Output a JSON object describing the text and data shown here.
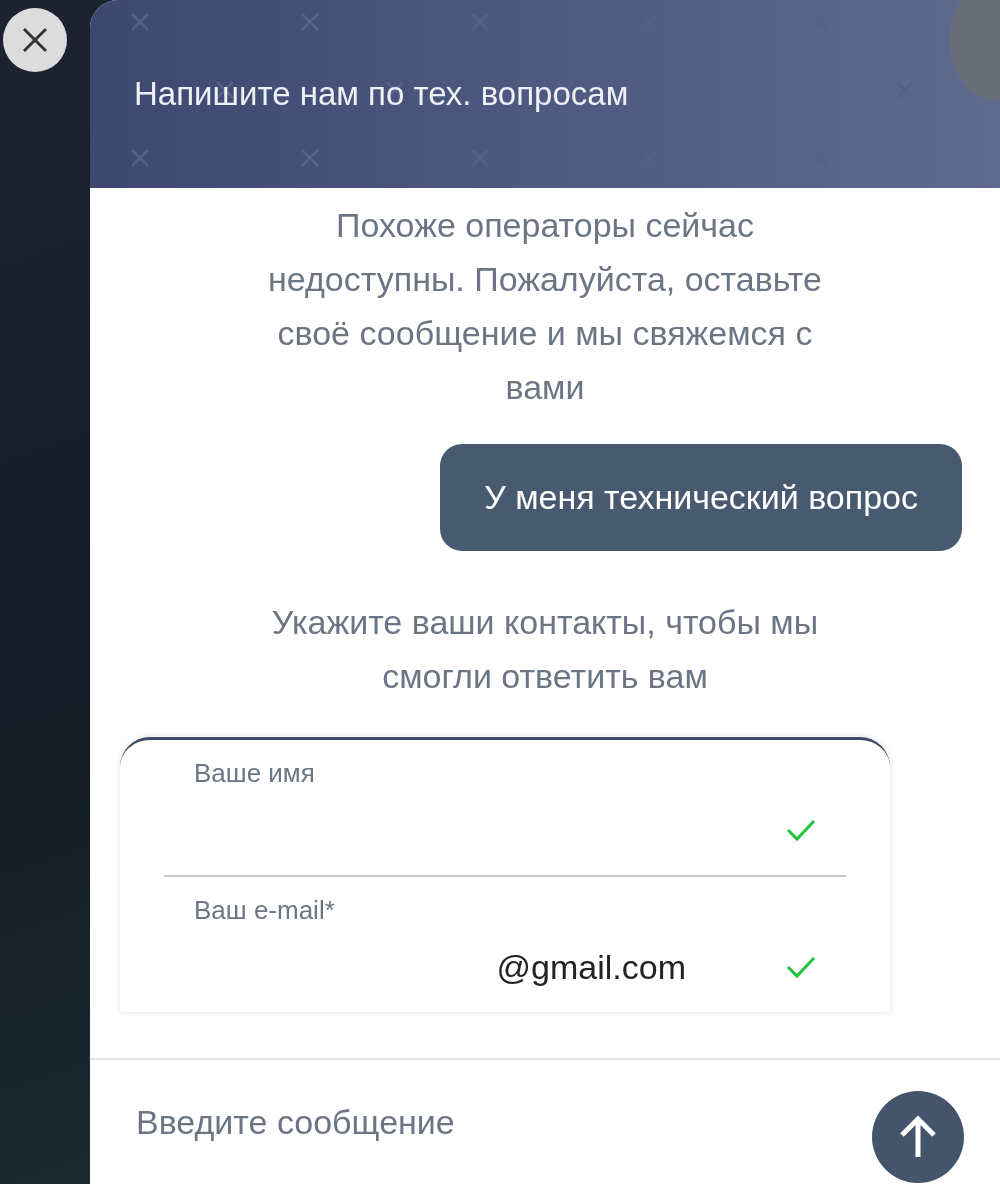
{
  "chat": {
    "title": "Напишите нам по тех. вопросам",
    "messages": [
      {
        "kind": "system",
        "text": "Похоже операторы сейчас недоступны. Пожалуйста, оставьте своё сообщение и мы свяжемся с вами"
      },
      {
        "kind": "user",
        "text": "У меня технический вопрос"
      },
      {
        "kind": "system",
        "text": "Укажите ваши контакты, чтобы мы смогли ответить вам"
      }
    ],
    "form": {
      "fields": [
        {
          "label": "Ваше имя",
          "valid": true
        },
        {
          "label": "Ваш e-mail*",
          "value": "@gmail.com",
          "valid": true
        }
      ]
    },
    "composer": {
      "placeholder": "Введите сообщение"
    }
  }
}
